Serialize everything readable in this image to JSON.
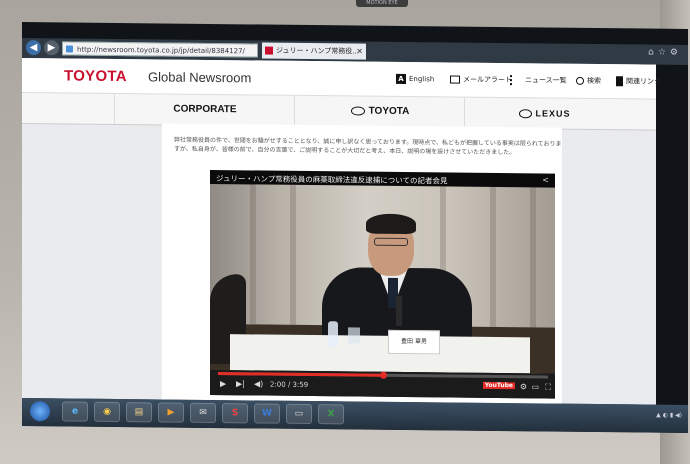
{
  "bezel": {
    "brand": "MOTION EYE"
  },
  "browser": {
    "address": "http://newsroom.toyota.co.jp/jp/detail/8384127/",
    "tab_label": "ジュリー・ハンプ常務役...",
    "tab_close": "×"
  },
  "header": {
    "logo": "TOYOTA",
    "logo_sub": "Global Newsroom",
    "nav": [
      {
        "label": "English",
        "icon": "english-icon"
      },
      {
        "label": "メールアラート",
        "icon": "mail-icon"
      },
      {
        "label": "ニュース一覧",
        "icon": "list-icon"
      },
      {
        "label": "検索",
        "icon": "search-icon"
      },
      {
        "label": "関連リンク",
        "icon": "bookmark-icon"
      }
    ]
  },
  "brands": {
    "corporate": "CORPORATE",
    "toyota": "TOYOTA",
    "lexus": "LEXUS"
  },
  "notice_text": "弊社常務役員の件で、世間をお騒がせすることとなり、誠に申し訳なく思っております。現時点で、私どもが把握している事実は限られておりますが、私自身が、皆様の前で、自分の言葉で、ご説明することが大切だと考え、本日、説明の場を設けさせていただきました。",
  "video": {
    "title": "ジュリー・ハンプ常務役員の麻薬取締法違反逮捕についての記者会見",
    "nameplate": "豊田 章男",
    "time": "2:00 / 3:59",
    "progress": 0.5,
    "youtube": "YouTube"
  },
  "colors": {
    "brand_red": "#c8102e",
    "progress_red": "#e52d27"
  }
}
